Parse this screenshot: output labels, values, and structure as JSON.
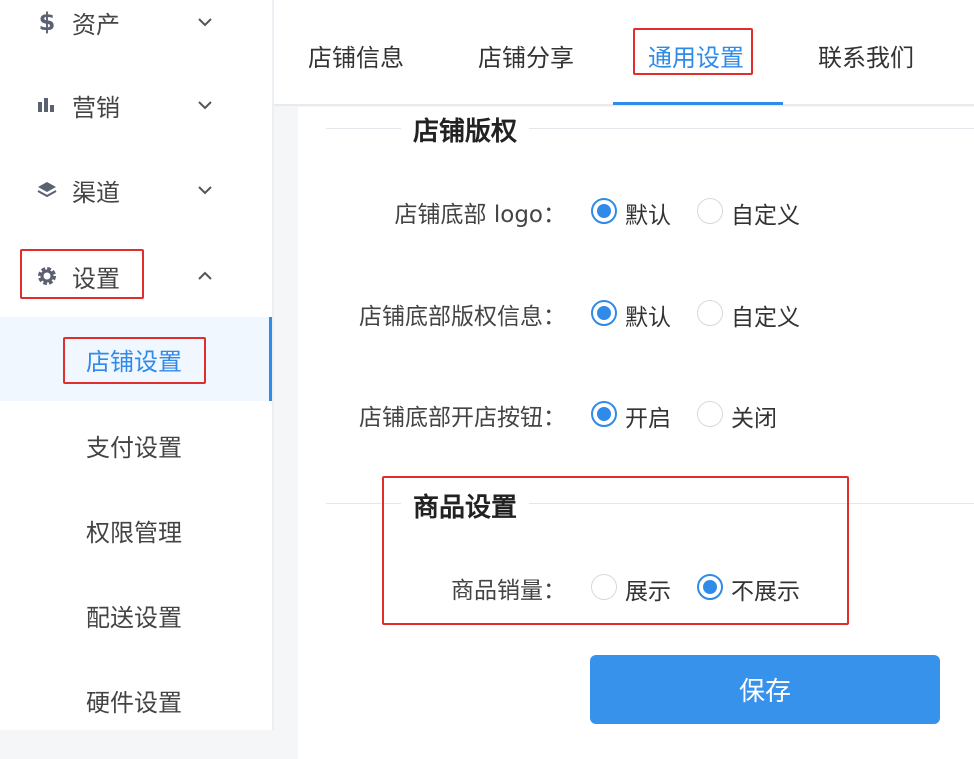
{
  "sidebar": {
    "groups": [
      {
        "label": "资产",
        "icon": "dollar-icon"
      },
      {
        "label": "营销",
        "icon": "bar-chart-icon"
      },
      {
        "label": "渠道",
        "icon": "layers-icon"
      },
      {
        "label": "设置",
        "icon": "gear-icon"
      }
    ],
    "sub_items": [
      {
        "label": "店铺设置",
        "active": true
      },
      {
        "label": "支付设置"
      },
      {
        "label": "权限管理"
      },
      {
        "label": "配送设置"
      },
      {
        "label": "硬件设置"
      }
    ]
  },
  "tabs": [
    {
      "label": "店铺信息"
    },
    {
      "label": "店铺分享"
    },
    {
      "label": "通用设置",
      "active": true
    },
    {
      "label": "联系我们"
    }
  ],
  "copyright_section": {
    "title": "店铺版权",
    "rows": [
      {
        "label": "店铺底部 logo：",
        "options": [
          "默认",
          "自定义"
        ],
        "selected": "默认"
      },
      {
        "label": "店铺底部版权信息：",
        "options": [
          "默认",
          "自定义"
        ],
        "selected": "默认"
      },
      {
        "label": "店铺底部开店按钮：",
        "options": [
          "开启",
          "关闭"
        ],
        "selected": "开启"
      }
    ]
  },
  "product_section": {
    "title": "商品设置",
    "rows": [
      {
        "label": "商品销量：",
        "options": [
          "展示",
          "不展示"
        ],
        "selected": "不展示"
      }
    ]
  },
  "save_label": "保存",
  "colors": {
    "accent": "#2f8ae8",
    "highlight": "#e02d2d"
  }
}
